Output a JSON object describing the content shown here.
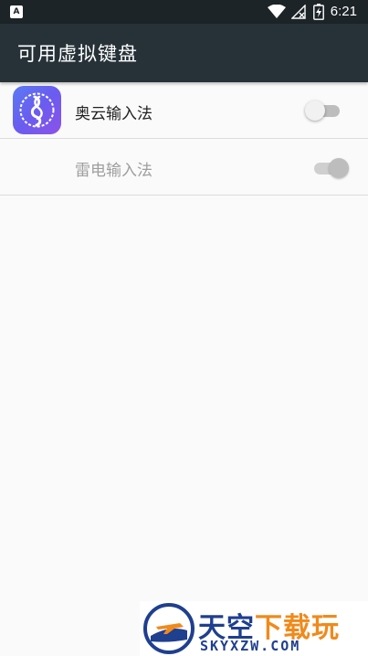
{
  "status_bar": {
    "time": "6:21",
    "left_icon_glyph": "A",
    "icons": [
      "notification-a-icon",
      "wifi-icon",
      "no-signal-icon",
      "battery-charging-icon"
    ]
  },
  "app_bar": {
    "title": "可用虚拟键盘",
    "background_color": "#263238"
  },
  "keyboards": [
    {
      "label": "奥云输入法",
      "enabled": false,
      "disabled": false,
      "icon": "aoyun-app-icon"
    },
    {
      "label": "雷电输入法",
      "enabled": true,
      "disabled": true,
      "icon": ""
    }
  ],
  "watermark": {
    "brand_prefix": "天空",
    "brand_suffix": "下载玩",
    "domain": "SKYXZW.COM"
  }
}
